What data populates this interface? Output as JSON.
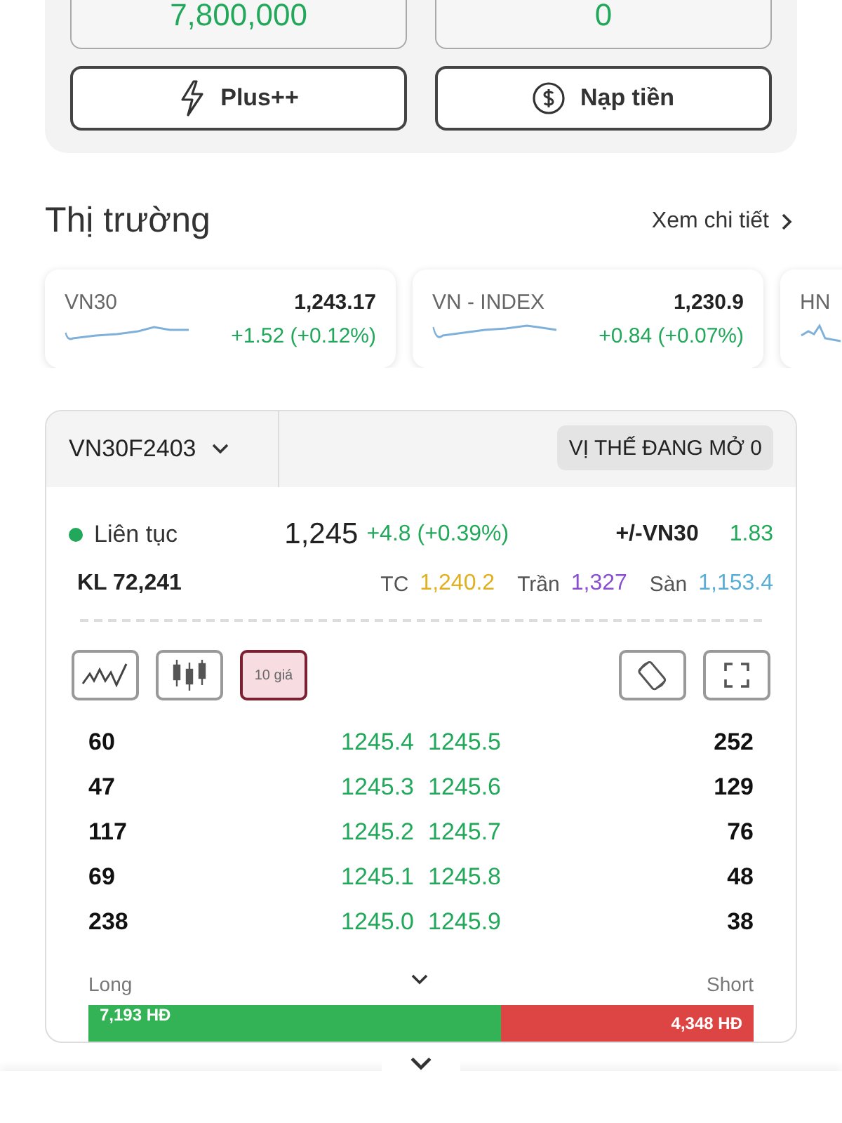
{
  "balances": [
    {
      "value": "7,800,000"
    },
    {
      "value": "0"
    }
  ],
  "actions": [
    {
      "kind": "plus",
      "label": "Plus++"
    },
    {
      "kind": "deposit",
      "label": "Nạp tiền"
    }
  ],
  "market": {
    "title": "Thị trường",
    "link": "Xem chi tiết",
    "indices": [
      {
        "name": "VN30",
        "value": "1,243.17",
        "change": "+1.52 (+0.12%)"
      },
      {
        "name": "VN - INDEX",
        "value": "1,230.9",
        "change": "+0.84 (+0.07%)"
      },
      {
        "name": "HN"
      }
    ]
  },
  "contract": {
    "symbol": "VN30F2403",
    "open_positions": "VỊ THẾ ĐANG MỞ 0",
    "status": "Liên tục",
    "price": "1,245",
    "change": "+4.8 (+0.39%)",
    "basis_label": "+/-VN30",
    "basis": "1.83",
    "volume": "KL 72,241",
    "ref_prices": [
      {
        "label": "TC",
        "value": "1,240.2",
        "color": "#e0b020"
      },
      {
        "label": "Trần",
        "value": "1,327",
        "color": "#8a4fd0"
      },
      {
        "label": "Sàn",
        "value": "1,153.4",
        "color": "#5aaed6"
      }
    ]
  },
  "tools": [
    {
      "kind": "line",
      "selected": false
    },
    {
      "kind": "candle",
      "selected": false
    },
    {
      "kind": "depth",
      "label": "10 giá",
      "selected": true
    }
  ],
  "order_book": [
    {
      "bid_qty": "60",
      "bid": "1245.4",
      "ask": "1245.5",
      "ask_qty": "252"
    },
    {
      "bid_qty": "47",
      "bid": "1245.3",
      "ask": "1245.6",
      "ask_qty": "129"
    },
    {
      "bid_qty": "117",
      "bid": "1245.2",
      "ask": "1245.7",
      "ask_qty": "76"
    },
    {
      "bid_qty": "69",
      "bid": "1245.1",
      "ask": "1245.8",
      "ask_qty": "48"
    },
    {
      "bid_qty": "238",
      "bid": "1245.0",
      "ask": "1245.9",
      "ask_qty": "38"
    }
  ],
  "long_short": {
    "long_label": "Long",
    "short_label": "Short",
    "long": "7,193 HĐ",
    "short": "4,348 HĐ",
    "level": 0.62
  }
}
